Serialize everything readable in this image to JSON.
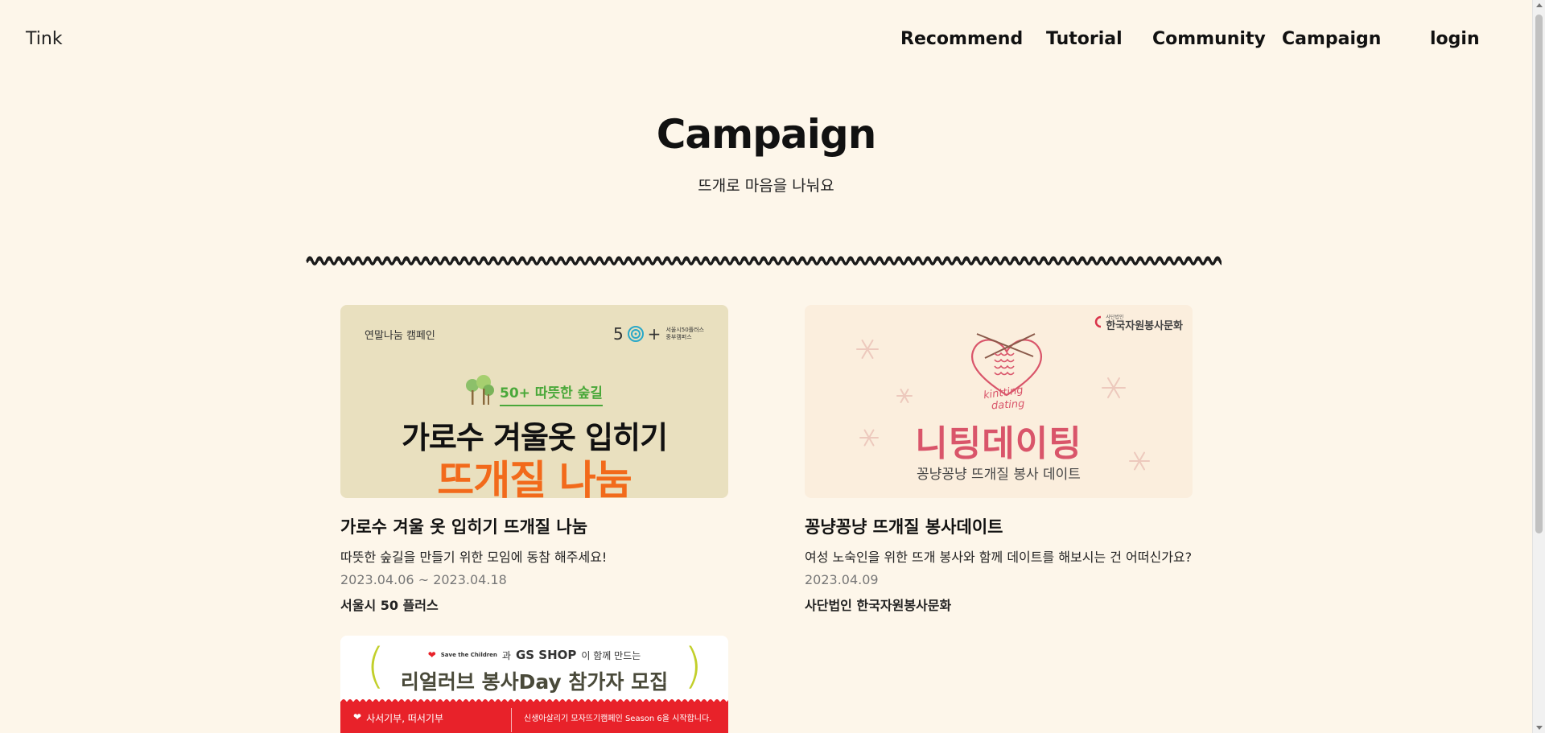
{
  "header": {
    "logo": "Tink",
    "nav": [
      "Recommend",
      "Tutorial",
      "Community",
      "Campaign",
      "login"
    ]
  },
  "hero": {
    "title": "Campaign",
    "subtitle": "뜨개로 마음을 나눠요"
  },
  "cards": [
    {
      "title": "가로수 겨울 옷 입히기 뜨개질 나눔",
      "description": "따뜻한 숲길을 만들기 위한 모임에 동참 해주세요!",
      "date": "2023.04.06 ~ 2023.04.18",
      "organizer": "서울시 50 플러스",
      "image": {
        "tag": "연말나눔 캠페인",
        "partner_num": "5",
        "partner_plus": "+",
        "partner_line1": "서울시50플러스",
        "partner_line2": "중부캠퍼스",
        "sub": "50+ 따뜻한 숲길",
        "headline": "가로수 겨울옷 입히기",
        "highlight": "뜨개질 나눔"
      }
    },
    {
      "title": "꽁냥꽁냥 뜨개질 봉사데이트",
      "description": "여성 노숙인을 위한 뜨개 봉사와 함께 데이트를 해보시는 건 어떠신가요?",
      "date": "2023.04.09",
      "organizer": "사단법인 한국자원봉사문화",
      "image": {
        "org_small": "사단법인",
        "org": "한국자원봉사문화",
        "script_line1": "kintting",
        "script_line2": "dating",
        "headline": "니팅데이팅",
        "sub": "꽁냥꽁냥 뜨개질 봉사 데이트"
      }
    },
    {
      "image": {
        "brand1": "Save the Children",
        "conj": "과",
        "brand2": "GS SHOP",
        "suffix": "이 함께 만드는",
        "headline": "리얼러브 봉사Day 참가자 모집",
        "left1": "사서기부, 떠서기부",
        "right1": "신생아살리기 모자뜨기캠페인 Season 6을 시작합니다."
      }
    }
  ],
  "colors": {
    "background": "#fdf6ea",
    "card1_bg": "#e9e0bf",
    "card1_highlight": "#f26a1b",
    "card2_bg": "#fbeedd",
    "card2_headline": "#d9556a",
    "card3_red": "#e8222a",
    "card3_bracket": "#c2cf2a"
  }
}
